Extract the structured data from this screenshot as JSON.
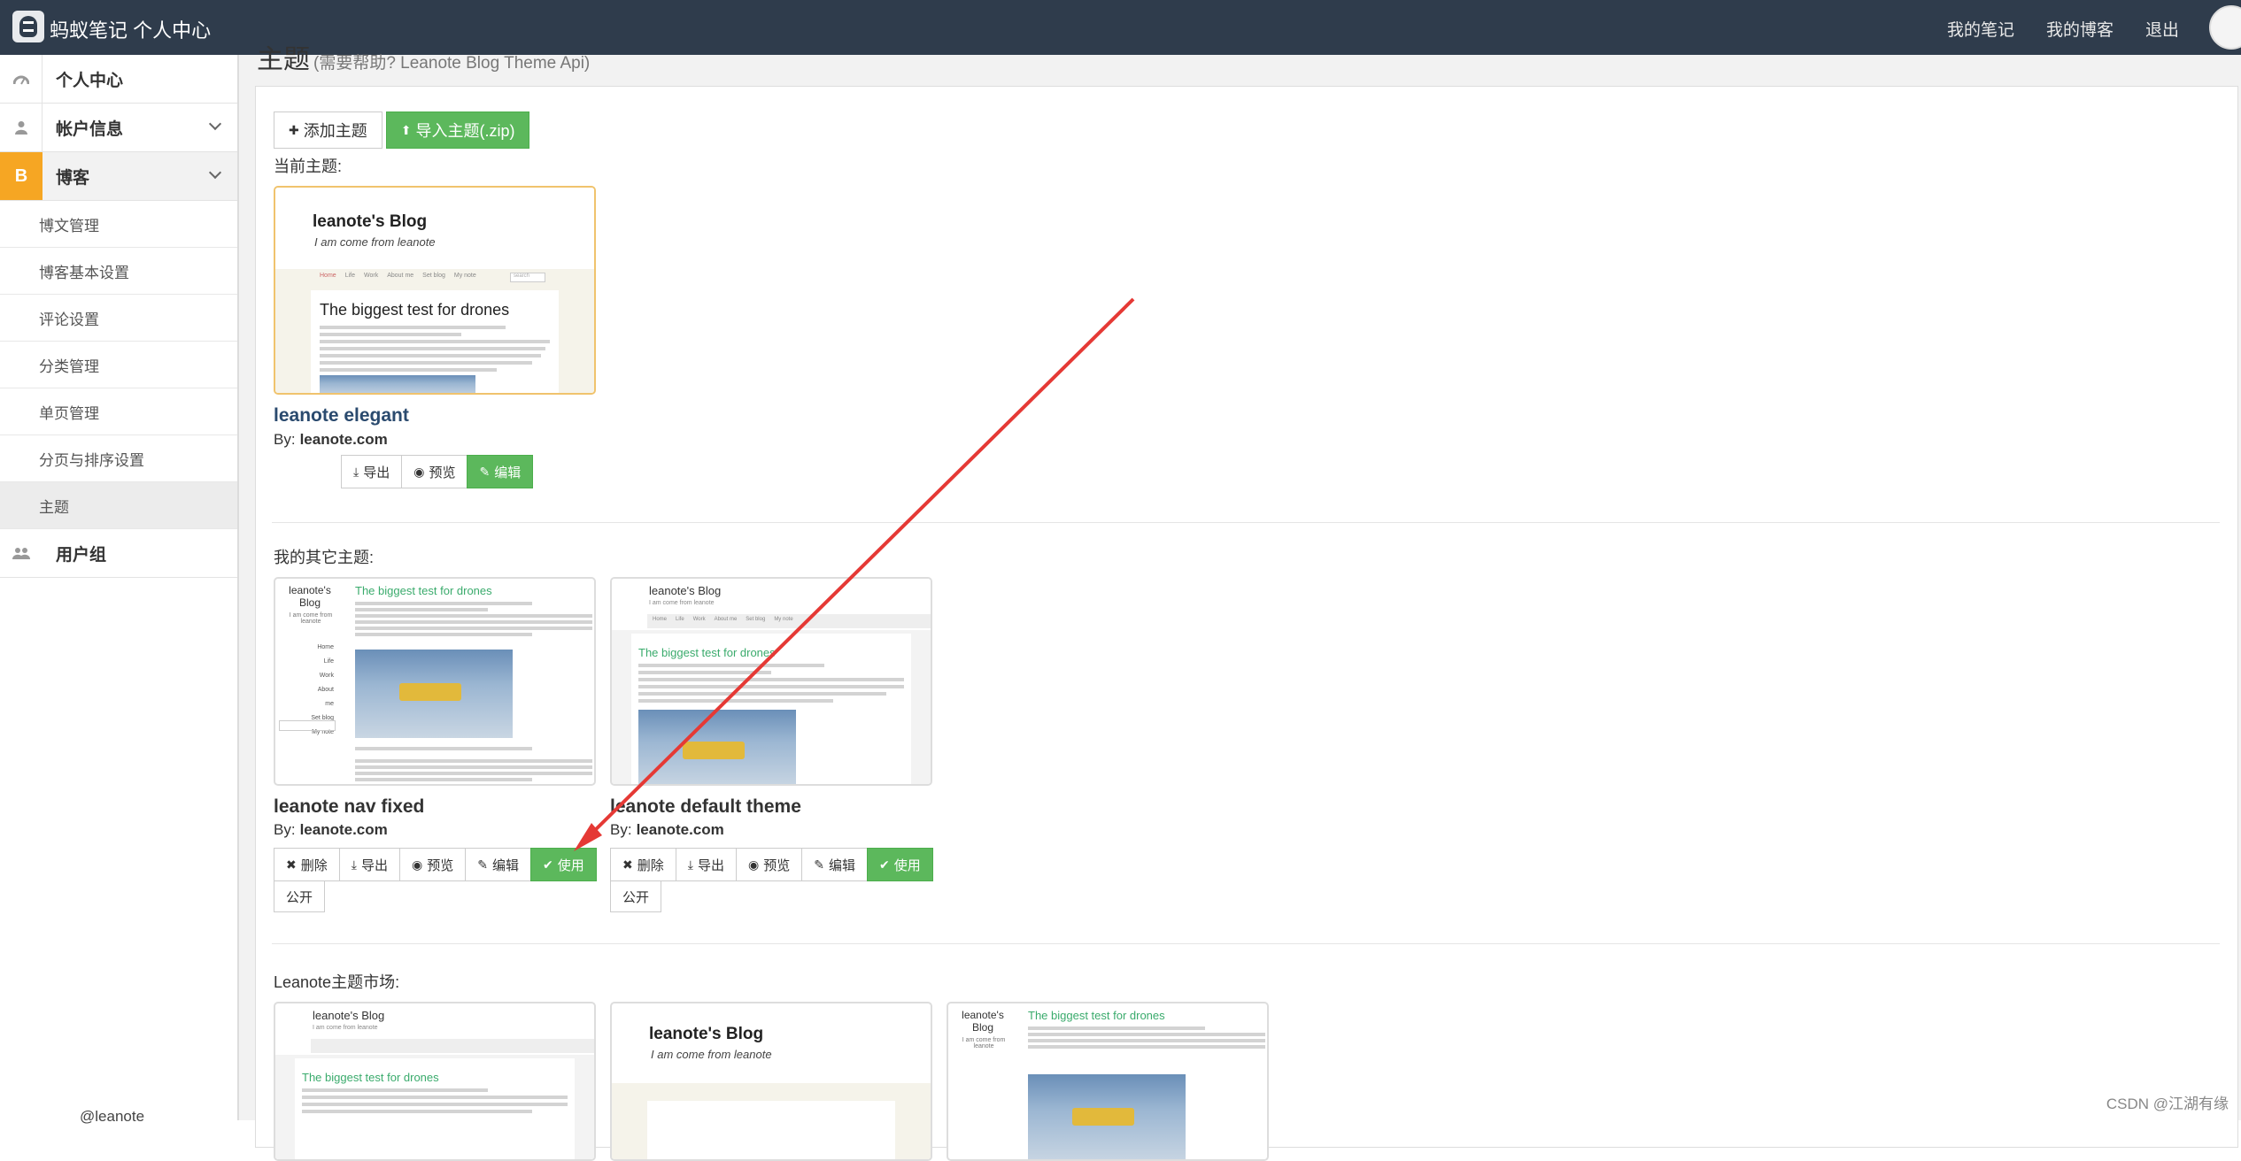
{
  "topbar": {
    "brand": "蚂蚁笔记 个人中心",
    "nav": [
      "我的笔记",
      "我的博客",
      "退出"
    ]
  },
  "sidebar": {
    "items": [
      {
        "label": "个人中心",
        "icon": "dashboard-icon"
      },
      {
        "label": "帐户信息",
        "icon": "user-icon"
      },
      {
        "label": "博客",
        "icon": "blog-icon",
        "icon_text": "B"
      },
      {
        "label": "用户组",
        "icon": "users-icon"
      }
    ],
    "blog_sub": [
      "博文管理",
      "博客基本设置",
      "评论设置",
      "分类管理",
      "单页管理",
      "分页与排序设置",
      "主题"
    ],
    "active_sub": "主题",
    "bottom_text": "@leanote"
  },
  "page": {
    "title": "主题",
    "subtitle": "(需要帮助? Leanote Blog Theme Api)",
    "add_theme": "添加主题",
    "import_theme": "导入主题(.zip)",
    "current_label": "当前主题:",
    "other_label": "我的其它主题:",
    "market_label": "Leanote主题市场:"
  },
  "current_theme": {
    "name": "leanote elegant",
    "by_label": "By:",
    "author": "leanote.com",
    "actions": [
      "导出",
      "预览",
      "编辑"
    ],
    "preview": {
      "blog_title": "leanote's Blog",
      "tagline": "I am come from leanote",
      "nav": [
        "Home",
        "Life",
        "Work",
        "About me",
        "Set blog",
        "My note"
      ],
      "search": "search",
      "post_title": "The biggest test for drones"
    }
  },
  "other_themes": [
    {
      "name": "leanote nav fixed",
      "by_label": "By:",
      "author": "leanote.com",
      "actions": [
        "删除",
        "导出",
        "预览",
        "编辑",
        "使用"
      ],
      "public_label": "公开",
      "preview": {
        "blog_title": "leanote's Blog",
        "tagline": "I am come from leanote",
        "post_title": "The biggest test for drones",
        "nav": [
          "Home",
          "Life",
          "Work",
          "About me",
          "Set blog",
          "My note"
        ]
      }
    },
    {
      "name": "leanote default theme",
      "by_label": "By:",
      "author": "leanote.com",
      "actions": [
        "删除",
        "导出",
        "预览",
        "编辑",
        "使用"
      ],
      "public_label": "公开",
      "preview": {
        "blog_title": "leanote's Blog",
        "tagline": "I am come from leanote",
        "post_title": "The biggest test for drones",
        "nav": [
          "Home",
          "Life",
          "Work",
          "About me",
          "Set blog",
          "My note"
        ]
      }
    }
  ],
  "market_themes": [
    {
      "preview": {
        "blog_title": "leanote's Blog",
        "tagline": "I am come from leanote",
        "post_title": "The biggest test for drones"
      }
    },
    {
      "preview": {
        "blog_title": "leanote's Blog",
        "tagline": "I am come from leanote"
      }
    },
    {
      "preview": {
        "blog_title": "leanote's Blog",
        "tagline": "I am come from leanote",
        "post_title": "The biggest test for drones"
      }
    }
  ],
  "watermark": "CSDN @江湖有缘",
  "colors": {
    "topbar": "#2f3c4c",
    "accent_green": "#5cb85c",
    "blog_orange": "#f6a623",
    "annotation_red": "#e53935"
  }
}
